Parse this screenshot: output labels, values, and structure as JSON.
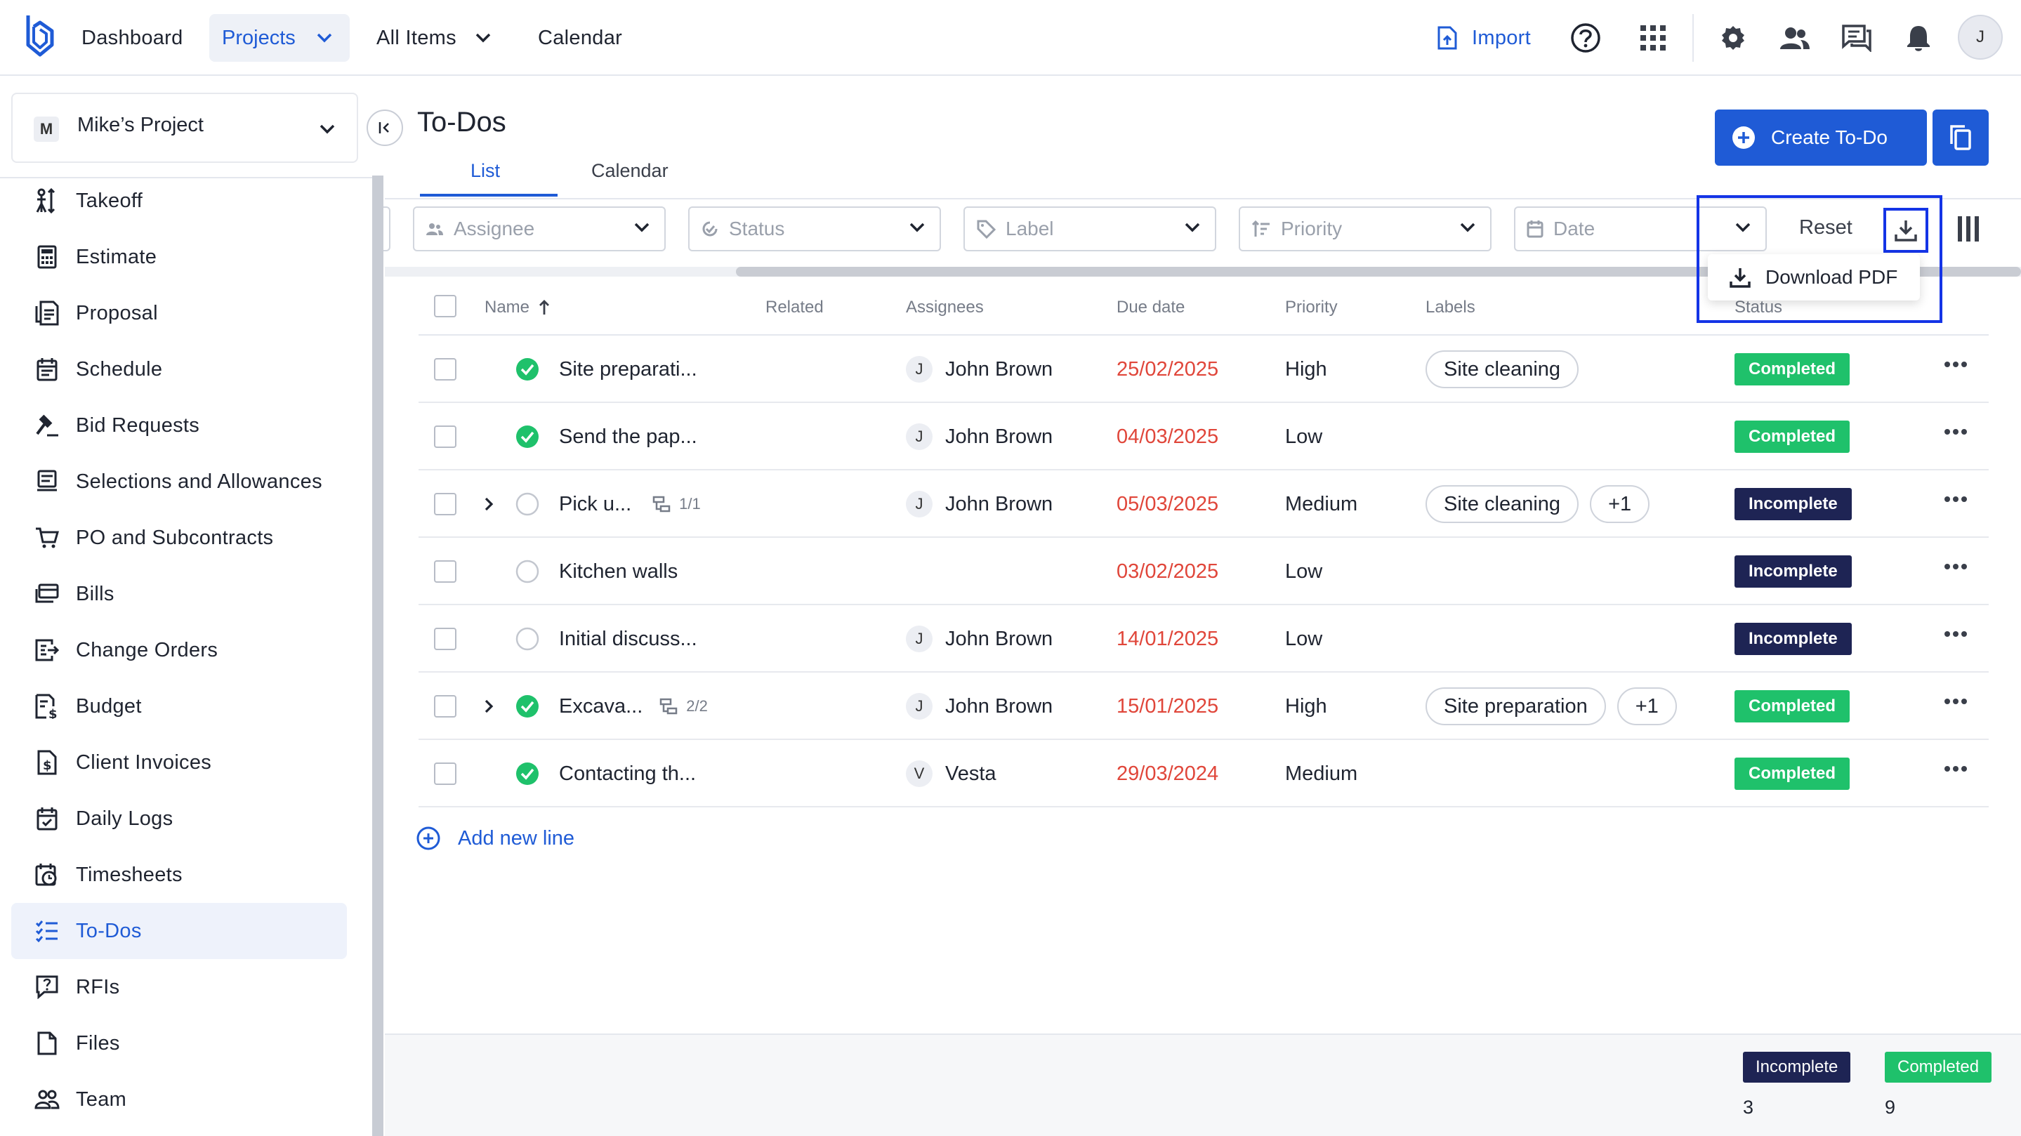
{
  "colors": {
    "accent": "#1f5bd6",
    "completed": "#1fc16b",
    "incomplete": "#1e2454",
    "due": "#e0463a",
    "highlight": "#1434e6"
  },
  "topnav": {
    "dashboard": "Dashboard",
    "projects": "Projects",
    "all_items": "All Items",
    "calendar": "Calendar",
    "import": "Import",
    "user_initial": "J"
  },
  "sidebar": {
    "project_initial": "M",
    "project_name": "Mike’s Project",
    "items": [
      {
        "label": "Takeoff",
        "icon": "takeoff-icon"
      },
      {
        "label": "Estimate",
        "icon": "calculator-icon"
      },
      {
        "label": "Proposal",
        "icon": "proposal-icon"
      },
      {
        "label": "Schedule",
        "icon": "schedule-icon"
      },
      {
        "label": "Bid Requests",
        "icon": "gavel-icon"
      },
      {
        "label": "Selections and Allowances",
        "icon": "selections-icon"
      },
      {
        "label": "PO and Subcontracts",
        "icon": "cart-icon"
      },
      {
        "label": "Bills",
        "icon": "bills-icon"
      },
      {
        "label": "Change Orders",
        "icon": "change-orders-icon"
      },
      {
        "label": "Budget",
        "icon": "budget-icon"
      },
      {
        "label": "Client Invoices",
        "icon": "invoice-icon"
      },
      {
        "label": "Daily Logs",
        "icon": "daily-logs-icon"
      },
      {
        "label": "Timesheets",
        "icon": "timesheets-icon"
      },
      {
        "label": "To-Dos",
        "icon": "todos-icon"
      },
      {
        "label": "RFIs",
        "icon": "rfi-icon"
      },
      {
        "label": "Files",
        "icon": "file-icon"
      },
      {
        "label": "Team",
        "icon": "team-icon"
      }
    ]
  },
  "page": {
    "title": "To-Dos",
    "tabs": [
      "List",
      "Calendar"
    ],
    "create_button": "Create To-Do",
    "filters": {
      "assignee": "Assignee",
      "status": "Status",
      "label": "Label",
      "priority": "Priority",
      "date": "Date"
    },
    "reset": "Reset",
    "download_pdf": "Download PDF",
    "add_new_line": "Add new line"
  },
  "table": {
    "headers": {
      "name": "Name",
      "related": "Related",
      "assignees": "Assignees",
      "due_date": "Due date",
      "priority": "Priority",
      "labels": "Labels",
      "status": "Status"
    },
    "rows": [
      {
        "name": "Site preparati...",
        "done": true,
        "expandable": false,
        "subtasks": "",
        "assignee_initial": "J",
        "assignee": "John Brown",
        "due": "25/02/2025",
        "priority": "High",
        "labels": [
          "Site cleaning"
        ],
        "status": "Completed"
      },
      {
        "name": "Send the pap...",
        "done": true,
        "expandable": false,
        "subtasks": "",
        "assignee_initial": "J",
        "assignee": "John Brown",
        "due": "04/03/2025",
        "priority": "Low",
        "labels": [],
        "status": "Completed"
      },
      {
        "name": "Pick u...",
        "done": false,
        "expandable": true,
        "subtasks": "1/1",
        "assignee_initial": "J",
        "assignee": "John Brown",
        "due": "05/03/2025",
        "priority": "Medium",
        "labels": [
          "Site cleaning",
          "+1"
        ],
        "status": "Incomplete"
      },
      {
        "name": "Kitchen walls",
        "done": false,
        "expandable": false,
        "subtasks": "",
        "assignee_initial": "",
        "assignee": "",
        "due": "03/02/2025",
        "priority": "Low",
        "labels": [],
        "status": "Incomplete"
      },
      {
        "name": "Initial discuss...",
        "done": false,
        "expandable": false,
        "subtasks": "",
        "assignee_initial": "J",
        "assignee": "John Brown",
        "due": "14/01/2025",
        "priority": "Low",
        "labels": [],
        "status": "Incomplete"
      },
      {
        "name": "Excava...",
        "done": true,
        "expandable": true,
        "subtasks": "2/2",
        "assignee_initial": "J",
        "assignee": "John Brown",
        "due": "15/01/2025",
        "priority": "High",
        "labels": [
          "Site preparation",
          "+1"
        ],
        "status": "Completed"
      },
      {
        "name": "Contacting th...",
        "done": true,
        "expandable": false,
        "subtasks": "",
        "assignee_initial": "V",
        "assignee": "Vesta",
        "due": "29/03/2024",
        "priority": "Medium",
        "labels": [],
        "status": "Completed"
      }
    ]
  },
  "summary": {
    "incomplete_label": "Incomplete",
    "incomplete_count": "3",
    "completed_label": "Completed",
    "completed_count": "9"
  }
}
